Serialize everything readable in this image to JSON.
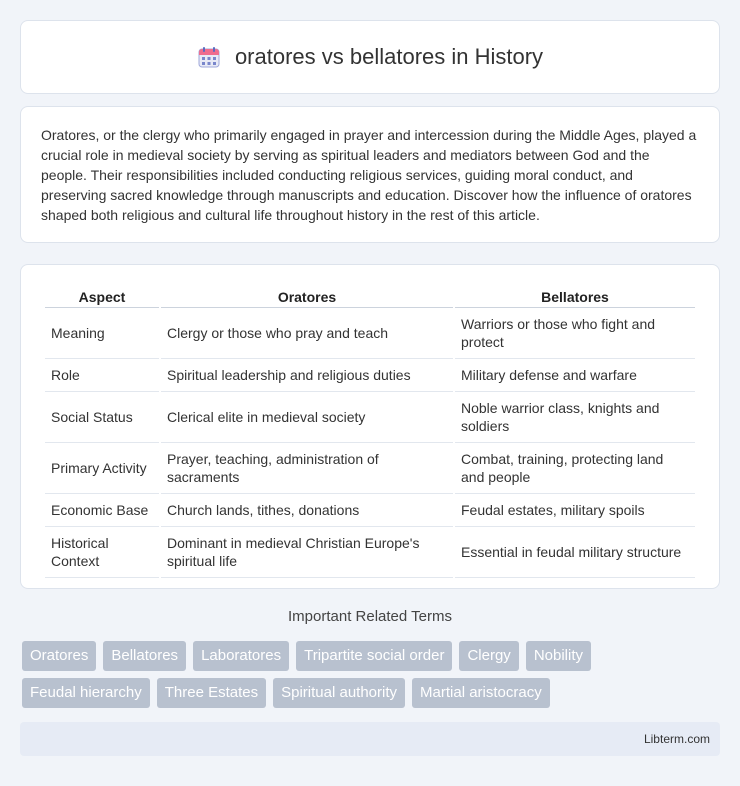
{
  "header": {
    "title": "oratores vs bellatores in History",
    "icon": "calendar-icon"
  },
  "intro": {
    "text": "Oratores, or the clergy who primarily engaged in prayer and intercession during the Middle Ages, played a crucial role in medieval society by serving as spiritual leaders and mediators between God and the people. Their responsibilities included conducting religious services, guiding moral conduct, and preserving sacred knowledge through manuscripts and education. Discover how the influence of oratores shaped both religious and cultural life throughout history in the rest of this article."
  },
  "table": {
    "headers": [
      "Aspect",
      "Oratores",
      "Bellatores"
    ],
    "rows": [
      [
        "Meaning",
        "Clergy or those who pray and teach",
        "Warriors or those who fight and protect"
      ],
      [
        "Role",
        "Spiritual leadership and religious duties",
        "Military defense and warfare"
      ],
      [
        "Social Status",
        "Clerical elite in medieval society",
        "Noble warrior class, knights and soldiers"
      ],
      [
        "Primary Activity",
        "Prayer, teaching, administration of sacraments",
        "Combat, training, protecting land and people"
      ],
      [
        "Economic Base",
        "Church lands, tithes, donations",
        "Feudal estates, military spoils"
      ],
      [
        "Historical Context",
        "Dominant in medieval Christian Europe's spiritual life",
        "Essential in feudal military structure"
      ]
    ]
  },
  "related": {
    "title": "Important Related Terms",
    "tags": [
      "Oratores",
      "Bellatores",
      "Laboratores",
      "Tripartite social order",
      "Clergy",
      "Nobility",
      "Feudal hierarchy",
      "Three Estates",
      "Spiritual authority",
      "Martial aristocracy"
    ]
  },
  "footer": {
    "site": "Libterm.com"
  }
}
